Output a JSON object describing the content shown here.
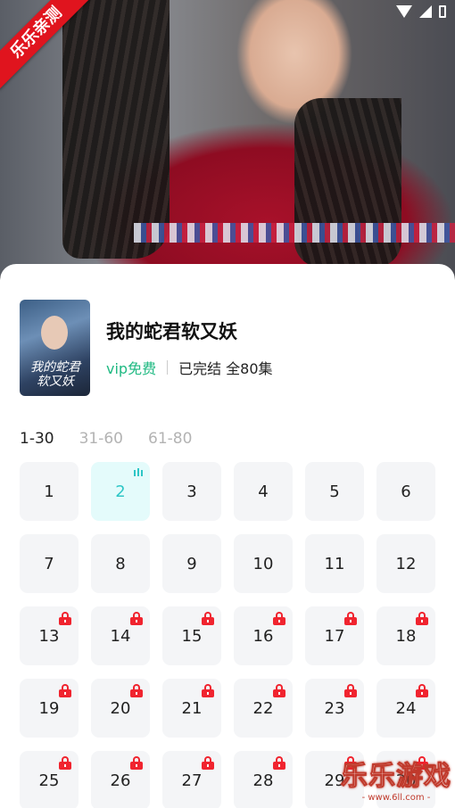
{
  "ribbon": "乐乐亲测",
  "drama": {
    "poster_title": "我的蛇君软又妖",
    "title": "我的蛇君软又妖",
    "vip": "vip免费",
    "status": "已完结 全80集"
  },
  "tabs": [
    {
      "label": "1-30",
      "active": true
    },
    {
      "label": "31-60",
      "active": false
    },
    {
      "label": "61-80",
      "active": false
    }
  ],
  "episodes": [
    {
      "n": "1",
      "state": "free"
    },
    {
      "n": "2",
      "state": "current"
    },
    {
      "n": "3",
      "state": "free"
    },
    {
      "n": "4",
      "state": "free"
    },
    {
      "n": "5",
      "state": "free"
    },
    {
      "n": "6",
      "state": "free"
    },
    {
      "n": "7",
      "state": "free"
    },
    {
      "n": "8",
      "state": "free"
    },
    {
      "n": "9",
      "state": "free"
    },
    {
      "n": "10",
      "state": "free"
    },
    {
      "n": "11",
      "state": "free"
    },
    {
      "n": "12",
      "state": "free"
    },
    {
      "n": "13",
      "state": "locked"
    },
    {
      "n": "14",
      "state": "locked"
    },
    {
      "n": "15",
      "state": "locked"
    },
    {
      "n": "16",
      "state": "locked"
    },
    {
      "n": "17",
      "state": "locked"
    },
    {
      "n": "18",
      "state": "locked"
    },
    {
      "n": "19",
      "state": "locked"
    },
    {
      "n": "20",
      "state": "locked"
    },
    {
      "n": "21",
      "state": "locked"
    },
    {
      "n": "22",
      "state": "locked"
    },
    {
      "n": "23",
      "state": "locked"
    },
    {
      "n": "24",
      "state": "locked"
    },
    {
      "n": "25",
      "state": "locked"
    },
    {
      "n": "26",
      "state": "locked"
    },
    {
      "n": "27",
      "state": "locked"
    },
    {
      "n": "28",
      "state": "locked"
    },
    {
      "n": "29",
      "state": "locked"
    },
    {
      "n": "30",
      "state": "locked"
    }
  ],
  "watermark": {
    "brand": "乐乐游戏",
    "url": "- www.6ll.com -"
  },
  "colors": {
    "vip": "#1fb982",
    "current": "#2ec6c6",
    "lock": "#f0242f",
    "ribbon": "#e0141e"
  }
}
